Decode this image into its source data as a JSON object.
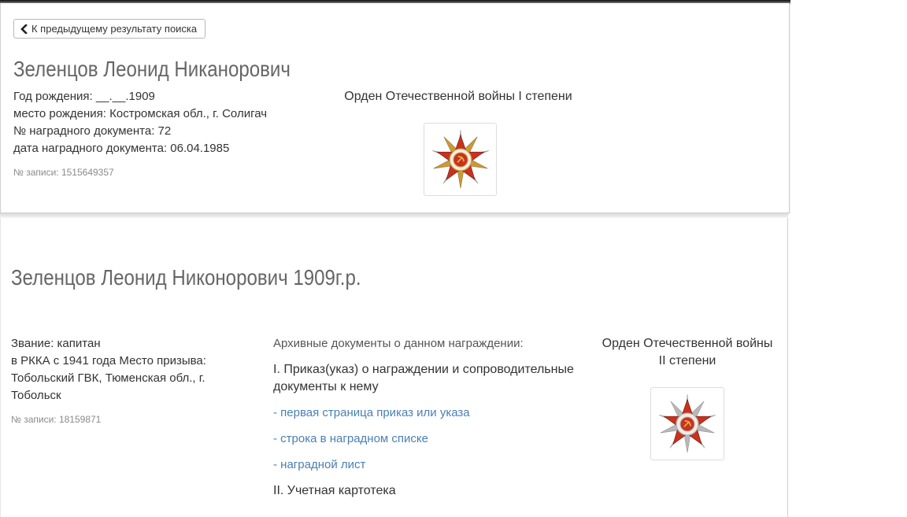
{
  "nav": {
    "back_label": "К предыдущему результату поиска"
  },
  "record1": {
    "name": "Зеленцов Леонид Никанорович",
    "birth_year": "Год рождения: __.__.1909",
    "birth_place": "место рождения: Костромская обл., г. Солигач",
    "award_doc_number": "№ наградного документа: 72",
    "award_doc_date": "дата наградного документа: 06.04.1985",
    "record_id": "№ записи: 1515649357",
    "award_title": "Орден Отечественной войны I степени",
    "award_icon": "order-patriotic-war-icon"
  },
  "record2": {
    "name": "Зеленцов Леонид Никонорович 1909г.р.",
    "rank": "Звание: капитан",
    "service_line1": "в РККА с 1941 года Место призыва:",
    "service_line2": "Тобольский ГВК, Тюменская обл., г.",
    "service_line3": "Тобольск",
    "record_id": "№ записи: 18159871",
    "archive_heading": "Архивные документы о данном награждении:",
    "section1_line1": "I. Приказ(указ) о награждении и сопроводительные",
    "section1_line2": "документы к нему",
    "links": [
      "- первая страница приказ или указа",
      "- строка в наградном списке",
      "- наградной лист"
    ],
    "section2": "II. Учетная картотека",
    "award_title_line1": "Орден Отечественной войны",
    "award_title_line2": "II степени",
    "award_icon": "order-patriotic-war-icon"
  },
  "colors": {
    "link": "#4a7fb5",
    "name": "#666666",
    "text": "#333333",
    "muted": "#8a8a8a"
  }
}
